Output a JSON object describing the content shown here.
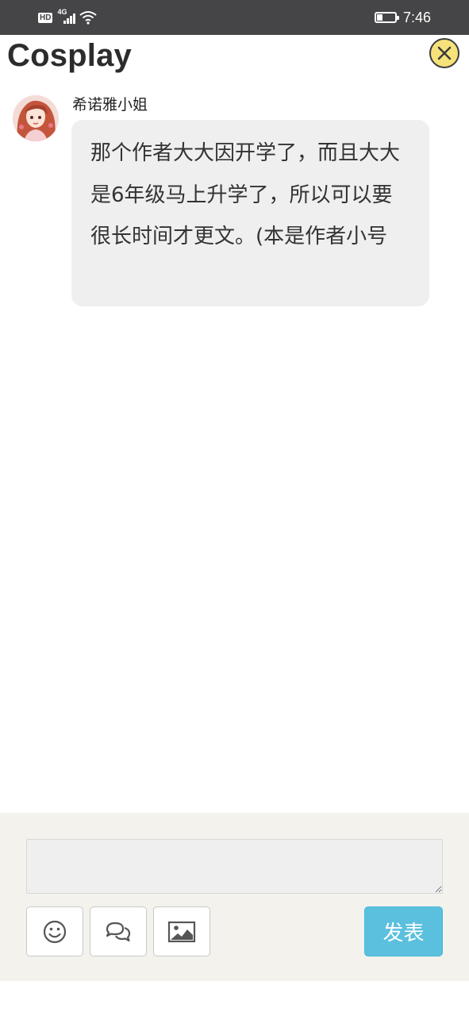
{
  "status_bar": {
    "hd_label": "HD",
    "network_label": "4G",
    "time": "7:46",
    "battery_level": 0.3
  },
  "header": {
    "title": "Cosplay",
    "close_icon": "close-circle-icon"
  },
  "message": {
    "username": "希诺雅小姐",
    "text": "那个作者大大因开学了，而且大大是6年级马上升学了，所以可以要很长时间才更文。(本是作者小号"
  },
  "composer": {
    "input_value": "",
    "tools": [
      "emoji-icon",
      "chat-bubbles-icon",
      "image-icon"
    ],
    "post_label": "发表",
    "post_color": "#5bc0de"
  },
  "colors": {
    "status_bar_bg": "#454547",
    "close_button_bg": "#f6e27a",
    "bubble_bg": "#efefef",
    "composer_bg": "#f3f2ec"
  }
}
